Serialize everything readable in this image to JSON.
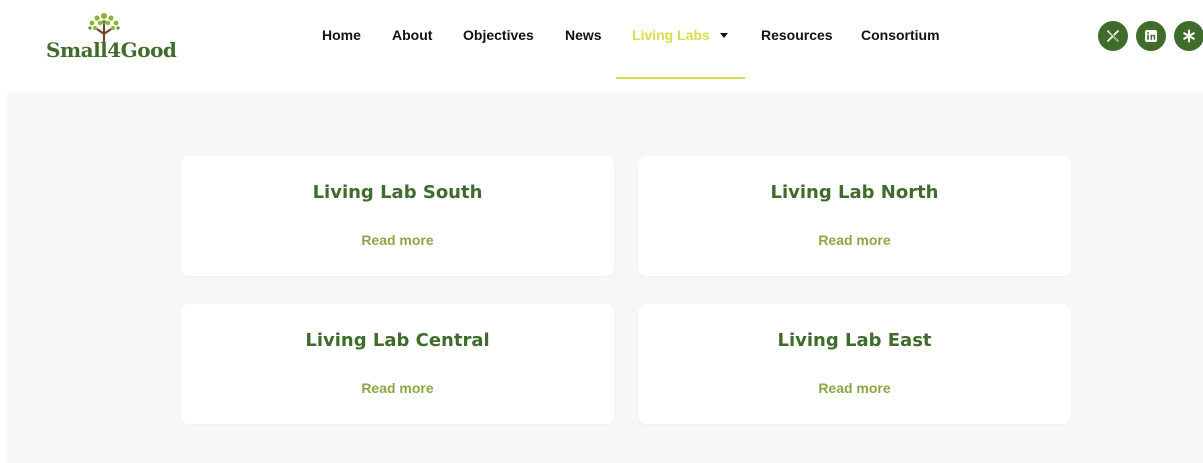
{
  "brand": {
    "name": "Small4Good",
    "primary_color": "#3f6b2b",
    "accent_color": "#d7de49",
    "link_color": "#8aa748"
  },
  "nav": {
    "items": [
      {
        "label": "Home"
      },
      {
        "label": "About"
      },
      {
        "label": "Objectives"
      },
      {
        "label": "News"
      },
      {
        "label": "Living Labs",
        "active": true,
        "has_dropdown": true
      },
      {
        "label": "Resources"
      },
      {
        "label": "Consortium"
      }
    ]
  },
  "social": [
    {
      "icon": "x-icon"
    },
    {
      "icon": "linkedin-icon"
    },
    {
      "icon": "asterisk-icon"
    }
  ],
  "cards": [
    {
      "title": "Living Lab South",
      "link": "Read more"
    },
    {
      "title": "Living Lab North",
      "link": "Read more"
    },
    {
      "title": "Living Lab Central",
      "link": "Read more"
    },
    {
      "title": "Living Lab East",
      "link": "Read more"
    }
  ]
}
